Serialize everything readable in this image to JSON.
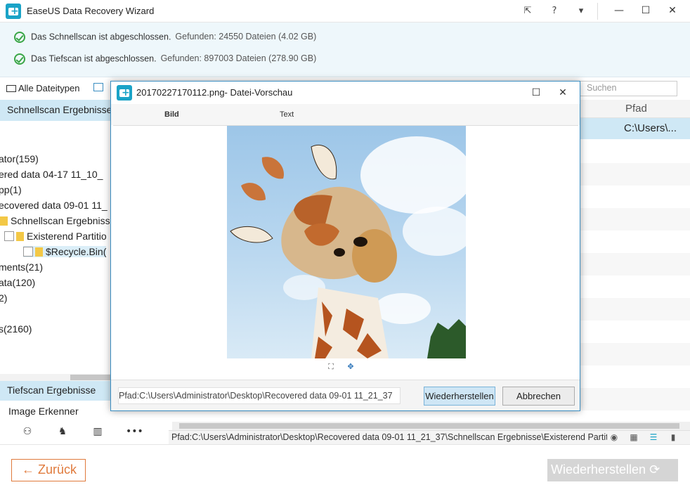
{
  "app": {
    "title": "EaseUS Data Recovery Wizard"
  },
  "status": {
    "quick_scan": "Das Schnellscan ist abgeschlossen.",
    "quick_found": "Gefunden: 24550 Dateien (4.02 GB)",
    "deep_scan": "Das Tiefscan ist abgeschlossen.",
    "deep_found": "Gefunden: 897003 Dateien (278.90 GB)"
  },
  "filter": {
    "all_types": "Alle Dateitypen",
    "search_placeholder": "Suchen"
  },
  "left": {
    "quick_header": "Schnellscan Ergebnisse",
    "tree": [
      "ator(159)",
      "ered data 04-17 11_10_",
      "pp(1)",
      "ecovered data 09-01 11_",
      "Schnellscan Ergebnisse",
      "Existerend Partitio",
      "$Recycle.Bin(",
      "ments(21)",
      "ata(120)",
      "2)",
      "s(2160)"
    ],
    "deep_header": "Tiefscan Ergebnisse",
    "image_recognizer": "Image Erkenner"
  },
  "right": {
    "column_path": "Pfad",
    "selected_path": "C:\\Users\\..."
  },
  "path_bar": "Pfad:C:\\Users\\Administrator\\Desktop\\Recovered data 09-01 11_21_37\\Schnellscan Ergebnisse\\Existerend Partition",
  "footer": {
    "back": "← Zurück",
    "restore": "Wiederherstellen ⟳"
  },
  "dialog": {
    "title": "20170227170112.png- Datei-Vorschau",
    "tab_image": "Bild",
    "tab_text": "Text",
    "path": "Pfad:C:\\Users\\Administrator\\Desktop\\Recovered data 09-01 11_21_37",
    "restore": "Wiederherstellen",
    "cancel": "Abbrechen"
  },
  "colors": {
    "accent": "#1aa3c7",
    "selection": "#cfe8f5",
    "back_button": "#e07a3c",
    "status_ok": "#3aa646"
  }
}
